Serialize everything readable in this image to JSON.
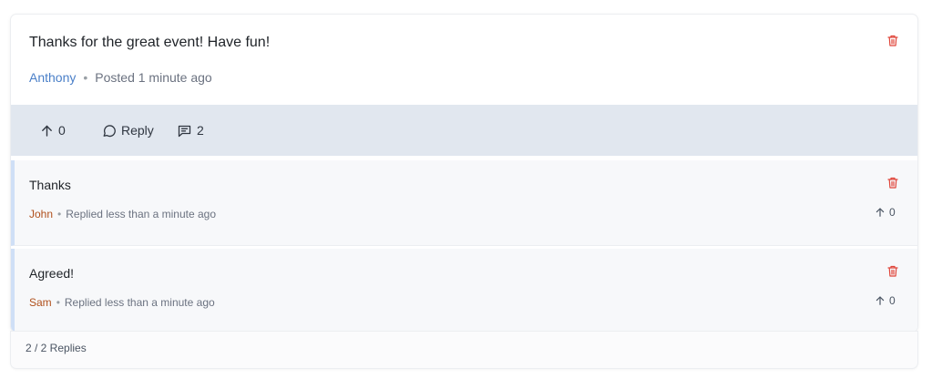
{
  "post": {
    "text": "Thanks for the great event! Have fun!",
    "author": "Anthony",
    "separator": "•",
    "posted": "Posted 1 minute ago",
    "upvotes": "0",
    "reply_label": "Reply",
    "comment_count": "2",
    "delete_icon": "trash-icon"
  },
  "replies": [
    {
      "text": "Thanks",
      "author": "John",
      "separator": "•",
      "time": "Replied less than a minute ago",
      "upvotes": "0"
    },
    {
      "text": "Agreed!",
      "author": "Sam",
      "separator": "•",
      "time": "Replied less than a minute ago",
      "upvotes": "0"
    }
  ],
  "footer": {
    "summary": "2 / 2 Replies"
  },
  "colors": {
    "author_link": "#4a7fc8",
    "reply_author": "#b0501c",
    "delete": "#e0453a",
    "action_bar": "#e1e7ef",
    "reply_border": "#cfdff6"
  }
}
